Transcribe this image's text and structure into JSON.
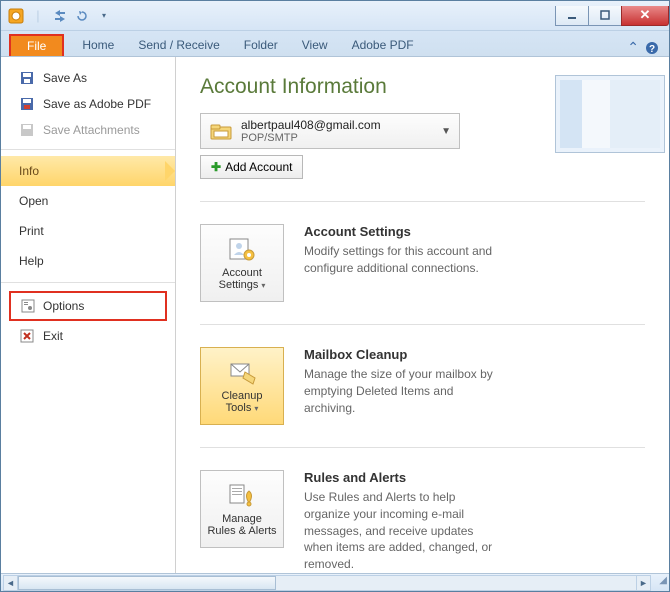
{
  "ribbon": {
    "tabs": [
      "File",
      "Home",
      "Send / Receive",
      "Folder",
      "View",
      "Adobe PDF"
    ]
  },
  "backstage": {
    "save_as": "Save As",
    "save_as_pdf": "Save as Adobe PDF",
    "save_attachments": "Save Attachments",
    "info": "Info",
    "open": "Open",
    "print": "Print",
    "help": "Help",
    "options": "Options",
    "exit": "Exit"
  },
  "page": {
    "title": "Account Information",
    "account": {
      "email": "albertpaul408@gmail.com",
      "protocol": "POP/SMTP"
    },
    "add_account": "Add Account",
    "sections": {
      "settings": {
        "btn": "Account Settings",
        "title": "Account Settings",
        "desc": "Modify settings for this account and configure additional connections."
      },
      "cleanup": {
        "btn": "Cleanup Tools",
        "title": "Mailbox Cleanup",
        "desc": "Manage the size of your mailbox by emptying Deleted Items and archiving."
      },
      "rules": {
        "btn": "Manage Rules & Alerts",
        "title": "Rules and Alerts",
        "desc": "Use Rules and Alerts to help organize your incoming e-mail messages, and receive updates when items are added, changed, or removed."
      }
    }
  }
}
